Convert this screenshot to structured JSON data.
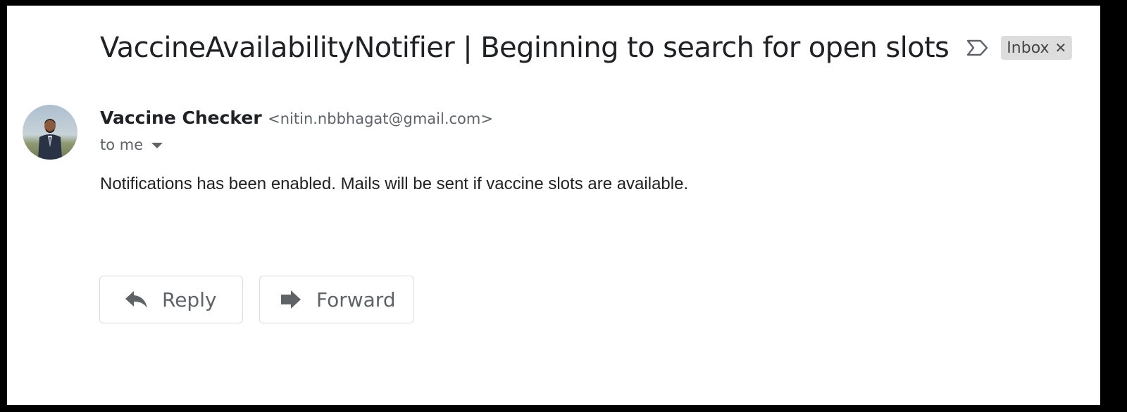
{
  "email": {
    "subject": "VaccineAvailabilityNotifier | Beginning to search for open slots",
    "labels": [
      {
        "name": "Inbox"
      }
    ],
    "sender": {
      "name": "Vaccine Checker",
      "email": "<nitin.nbbhagat@gmail.com>"
    },
    "recipient_text": "to me",
    "body": "Notifications has been enabled. Mails will be sent if vaccine slots are available."
  },
  "actions": {
    "reply_label": "Reply",
    "forward_label": "Forward"
  },
  "icons": {
    "importance": "importance-marker-icon",
    "chip_close": "close-icon",
    "caret": "chevron-down-icon",
    "reply": "reply-icon",
    "forward": "forward-icon"
  },
  "colors": {
    "frame_border": "#000000",
    "label_chip_bg": "#dddddd",
    "text_primary": "#202124",
    "text_secondary": "#5f6368",
    "button_border": "#dadce0"
  }
}
